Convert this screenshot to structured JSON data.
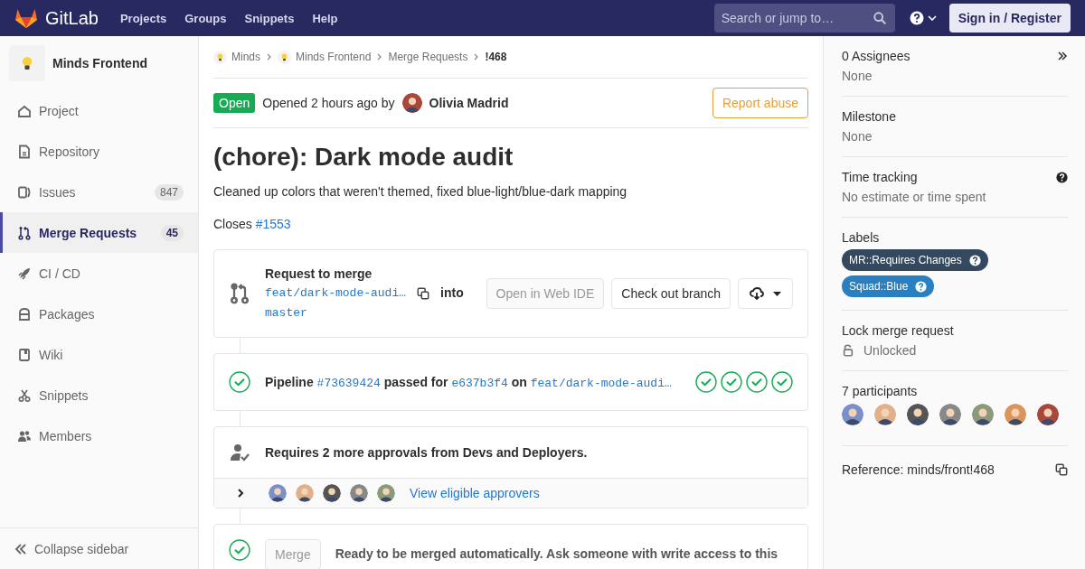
{
  "navbar": {
    "brand": "GitLab",
    "links": [
      "Projects",
      "Groups",
      "Snippets",
      "Help"
    ],
    "search": {
      "placeholder": "Search or jump to…"
    },
    "sign_in": "Sign in / Register"
  },
  "sidebar": {
    "project": "Minds Frontend",
    "items": [
      {
        "label": "Project",
        "kind": "home",
        "selected": false
      },
      {
        "label": "Repository",
        "kind": "doc",
        "selected": false
      },
      {
        "label": "Issues",
        "kind": "issues",
        "count": "847",
        "selected": false
      },
      {
        "label": "Merge Requests",
        "kind": "merge",
        "count": "45",
        "selected": true
      },
      {
        "label": "CI / CD",
        "kind": "rocket",
        "selected": false
      },
      {
        "label": "Packages",
        "kind": "package",
        "selected": false
      },
      {
        "label": "Wiki",
        "kind": "book",
        "selected": false
      },
      {
        "label": "Snippets",
        "kind": "scissors",
        "selected": false
      },
      {
        "label": "Members",
        "kind": "users",
        "selected": false
      }
    ],
    "collapse": "Collapse sidebar"
  },
  "breadcrumbs": [
    {
      "label": "Minds",
      "kind": "project"
    },
    {
      "label": "Minds Frontend",
      "kind": "project"
    },
    {
      "label": "Merge Requests",
      "kind": "link"
    },
    {
      "label": "!468",
      "kind": "current"
    }
  ],
  "header": {
    "status": "Open",
    "opened": "Opened 2 hours ago by",
    "author": "Olivia Madrid",
    "report": "Report abuse"
  },
  "title": "(chore): Dark mode audit",
  "description": "Cleaned up colors that weren't themed, fixed blue-light/blue-dark mapping",
  "closes": {
    "text": "Closes",
    "issue": "#1553"
  },
  "merge_request": {
    "title": "Request to merge",
    "source": "feat/dark-mode-audi…",
    "into": "into",
    "target": "master",
    "web_ide": {
      "label": "Open in Web IDE",
      "disabled": true
    },
    "checkout": "Check out branch"
  },
  "pipeline": {
    "label": "Pipeline",
    "id": "#73639424",
    "passed_for": "passed for",
    "commit": "e637b3f4",
    "on": "on",
    "branch": "feat/dark-mode-audi…",
    "stages": [
      {
        "passed": true
      },
      {
        "passed": true
      },
      {
        "passed": true
      },
      {
        "passed": true
      }
    ]
  },
  "approvals": {
    "text": "Requires 2 more approvals from Devs and Deployers.",
    "expanded": false,
    "link": "View eligible approvers"
  },
  "merge": {
    "button": "Merge",
    "text": "Ready to be merged automatically. Ask someone with write access to this"
  },
  "right_sidebar": {
    "assignees": {
      "title": "0 Assignees",
      "value": "None"
    },
    "milestone": {
      "title": "Milestone",
      "value": "None"
    },
    "time_tracking": {
      "title": "Time tracking",
      "value": "No estimate or time spent"
    },
    "labels": {
      "title": "Labels",
      "items": [
        {
          "text": "MR::Requires Changes",
          "color": "#34495e"
        },
        {
          "text": "Squad::Blue",
          "color": "#2a7fc0"
        }
      ]
    },
    "lock": {
      "title": "Lock merge request",
      "value": "Unlocked"
    },
    "participants": {
      "title": "7 participants"
    },
    "reference": "Reference: minds/front!468"
  }
}
